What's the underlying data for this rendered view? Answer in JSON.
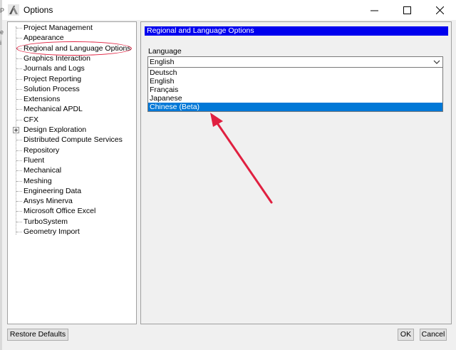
{
  "window": {
    "title": "Options",
    "minimize_glyph": "—",
    "maximize_glyph": "☐",
    "close_glyph": "✕"
  },
  "left_edge_chars": [
    "P",
    "e",
    "i"
  ],
  "tree": {
    "items": [
      {
        "label": "Project Management",
        "expandable": false
      },
      {
        "label": "Appearance",
        "expandable": false
      },
      {
        "label": "Regional and Language Options",
        "expandable": false,
        "selected": true
      },
      {
        "label": "Graphics Interaction",
        "expandable": false
      },
      {
        "label": "Journals and Logs",
        "expandable": false
      },
      {
        "label": "Project Reporting",
        "expandable": false
      },
      {
        "label": "Solution Process",
        "expandable": false
      },
      {
        "label": "Extensions",
        "expandable": false
      },
      {
        "label": "Mechanical APDL",
        "expandable": false
      },
      {
        "label": "CFX",
        "expandable": false
      },
      {
        "label": "Design Exploration",
        "expandable": true
      },
      {
        "label": "Distributed Compute Services",
        "expandable": false
      },
      {
        "label": "Repository",
        "expandable": false
      },
      {
        "label": "Fluent",
        "expandable": false
      },
      {
        "label": "Mechanical",
        "expandable": false
      },
      {
        "label": "Meshing",
        "expandable": false
      },
      {
        "label": "Engineering Data",
        "expandable": false
      },
      {
        "label": "Ansys Minerva",
        "expandable": false
      },
      {
        "label": "Microsoft Office Excel",
        "expandable": false
      },
      {
        "label": "TurboSystem",
        "expandable": false
      },
      {
        "label": "Geometry Import",
        "expandable": false
      }
    ]
  },
  "panel": {
    "section_title": "Regional and Language Options",
    "language_label": "Language",
    "language_value": "English",
    "options": [
      "Deutsch",
      "English",
      "Français",
      "Japanese",
      "Chinese (Beta)"
    ],
    "highlighted_option": 4
  },
  "buttons": {
    "restore_defaults": "Restore Defaults",
    "ok": "OK",
    "cancel": "Cancel"
  },
  "colors": {
    "section_bar": "#0000ee",
    "selection": "#0078d7",
    "annotation": "#e02040"
  }
}
